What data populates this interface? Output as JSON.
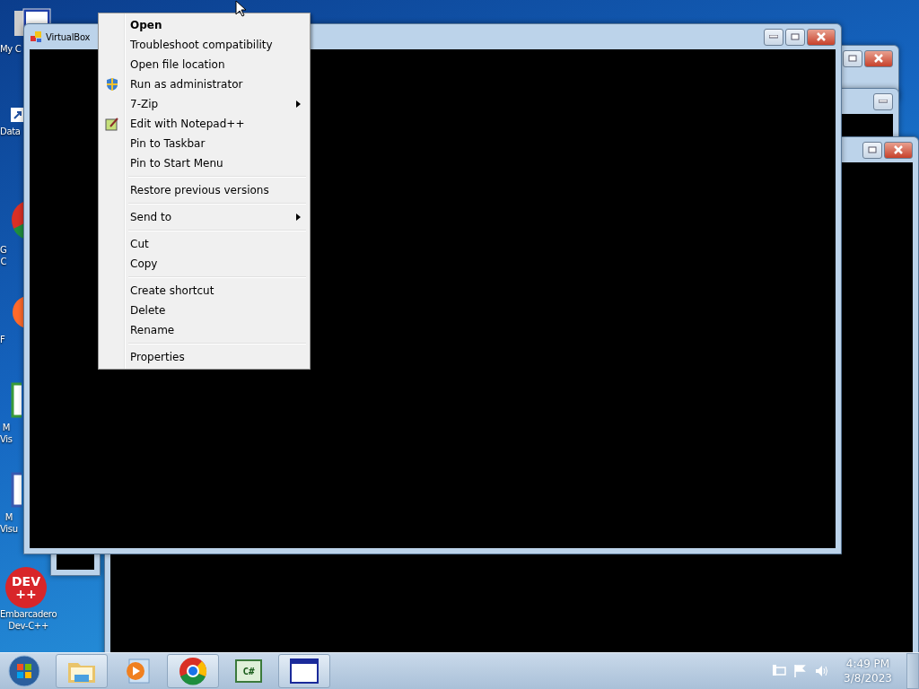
{
  "desktop_icons": [
    {
      "kind": "computer",
      "label_lines": [
        "My C"
      ]
    },
    {
      "kind": "database",
      "label_lines": [
        "Data"
      ]
    },
    {
      "kind": "chrome",
      "label_lines": [
        "G",
        "C"
      ]
    },
    {
      "kind": "firefox",
      "label_lines": [
        "F"
      ]
    },
    {
      "kind": "studio",
      "label_lines": [
        "M",
        "Vis"
      ]
    },
    {
      "kind": "studio2",
      "label_lines": [
        "M",
        "Visu"
      ]
    },
    {
      "kind": "devcpp",
      "badge_lines": [
        "DEV",
        "++"
      ],
      "label_lines": [
        "Embarcadero",
        "Dev-C++"
      ]
    }
  ],
  "window": {
    "title": "VirtualBox"
  },
  "context_menu": {
    "groups": [
      [
        {
          "label": "Open",
          "default": true,
          "submenu": false
        },
        {
          "label": "Troubleshoot compatibility",
          "default": false,
          "submenu": false
        },
        {
          "label": "Open file location",
          "default": false,
          "submenu": false
        },
        {
          "label": "Run as administrator",
          "default": false,
          "submenu": false,
          "kind": "admin"
        },
        {
          "label": "7-Zip",
          "default": false,
          "submenu": true
        },
        {
          "label": "Edit with Notepad++",
          "default": false,
          "submenu": false,
          "kind": "editor"
        },
        {
          "label": "Pin to Taskbar",
          "default": false,
          "submenu": false
        },
        {
          "label": "Pin to Start Menu",
          "default": false,
          "submenu": false
        }
      ],
      [
        {
          "label": "Restore previous versions",
          "default": false,
          "submenu": false
        }
      ],
      [
        {
          "label": "Send to",
          "default": false,
          "submenu": true
        }
      ],
      [
        {
          "label": "Cut",
          "default": false,
          "submenu": false
        },
        {
          "label": "Copy",
          "default": false,
          "submenu": false
        }
      ],
      [
        {
          "label": "Create shortcut",
          "default": false,
          "submenu": false
        },
        {
          "label": "Delete",
          "default": false,
          "submenu": false
        },
        {
          "label": "Rename",
          "default": false,
          "submenu": false
        }
      ],
      [
        {
          "label": "Properties",
          "default": false,
          "submenu": false
        }
      ]
    ]
  },
  "taskbar": {
    "items": [
      {
        "kind": "explorer",
        "running": true
      },
      {
        "kind": "media",
        "running": false
      },
      {
        "kind": "chrome",
        "running": true
      },
      {
        "kind": "csharp",
        "running": false,
        "text": "C#"
      },
      {
        "kind": "window",
        "running": true
      }
    ],
    "clock": {
      "time": "4:49 PM",
      "date": "3/8/2023"
    }
  }
}
